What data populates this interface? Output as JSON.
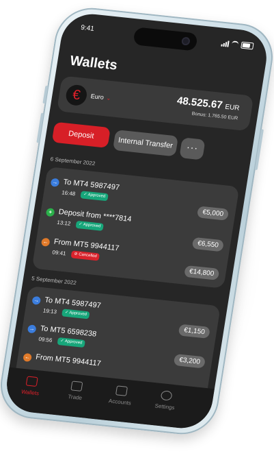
{
  "status": {
    "time": "9:41"
  },
  "header": {
    "title": "Wallets"
  },
  "balance": {
    "currency_symbol": "€",
    "currency_label": "Euro",
    "amount": "48.525.67",
    "amount_currency": "EUR",
    "bonus": "Bonus: 1.765.50  EUR"
  },
  "actions": {
    "deposit": "Deposit",
    "internal_transfer": "Internal Transfer",
    "more": "···"
  },
  "groups": [
    {
      "date": "6 September 2022",
      "transactions": [
        {
          "icon": "→",
          "title": "To MT4 5987497",
          "time": "16:48",
          "status": "Approved",
          "amount": "€5,000"
        },
        {
          "icon": "+",
          "title": "Deposit from ****7814",
          "time": "13:12",
          "status": "Approved",
          "amount": "€6,550"
        },
        {
          "icon": "←",
          "title": "From MT5 9944117",
          "time": "09:41",
          "status": "Cancelled",
          "amount": "€14,800"
        }
      ]
    },
    {
      "date": "5 September 2022",
      "transactions": [
        {
          "icon": "→",
          "title": "To MT4 5987497",
          "time": "19:13",
          "status": "Approved",
          "amount": "€1,150"
        },
        {
          "icon": "→",
          "title": "To MT5 6598238",
          "time": "09:56",
          "status": "Approved",
          "amount": "€3,200"
        },
        {
          "icon": "←",
          "title": "From MT5 9944117",
          "time": "",
          "status": "",
          "amount": ""
        }
      ]
    }
  ],
  "tabs": [
    {
      "label": "Wallets"
    },
    {
      "label": "Trade"
    },
    {
      "label": "Accounts"
    },
    {
      "label": "Settings"
    }
  ],
  "colors": {
    "accent": "#d71f27",
    "approved": "#17a67a",
    "cancelled": "#d9232c",
    "out_icon": "#3b7ddd",
    "in_icon": "#2bb04a",
    "from_icon": "#e07a2a"
  }
}
